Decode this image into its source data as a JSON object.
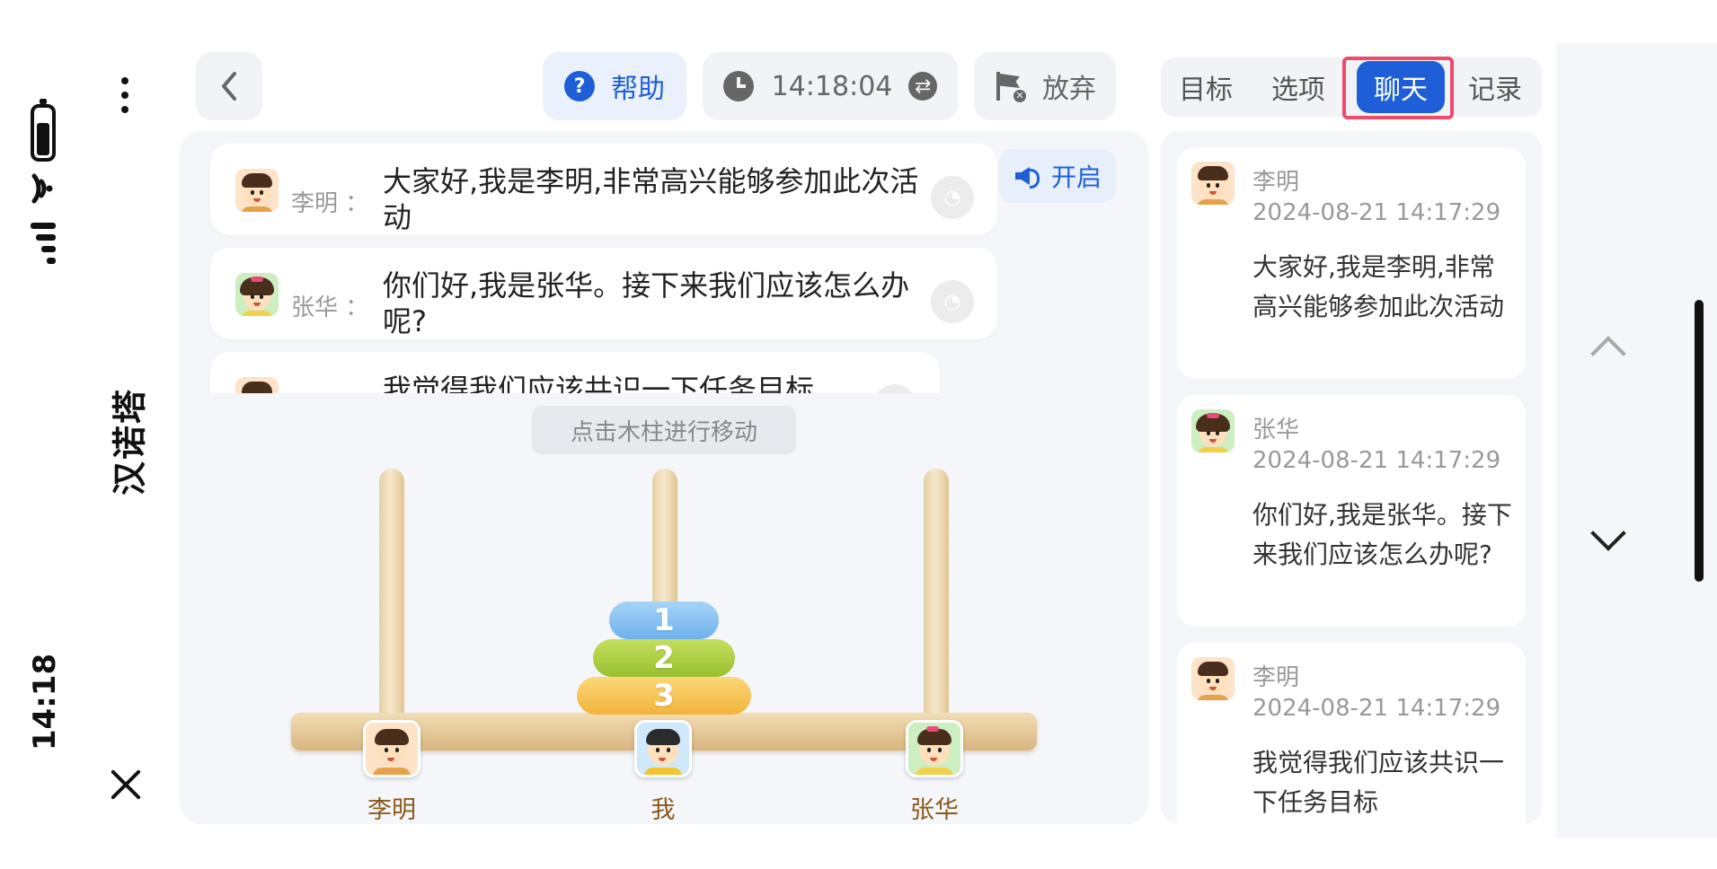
{
  "status_bar": {
    "time": "14:18",
    "icons": [
      "battery-icon",
      "wifi-icon",
      "signal-icon"
    ]
  },
  "app": {
    "title": "汉诺塔",
    "menu_icon": "more-vertical-icon",
    "close_icon": "close-icon"
  },
  "toolbar": {
    "back_icon": "chevron-left-icon",
    "help_label": "帮助",
    "timer_value": "14:18:04",
    "giveup_label": "放弃"
  },
  "tabs": [
    {
      "label": "目标",
      "active": false
    },
    {
      "label": "选项",
      "active": false
    },
    {
      "label": "聊天",
      "active": true
    },
    {
      "label": "记录",
      "active": false
    }
  ],
  "chat": {
    "separator": "：",
    "sound_toggle_label": "开启",
    "messages": [
      {
        "name": "李明",
        "text": "大家好,我是李明,非常高兴能够参加此次活动"
      },
      {
        "name": "张华",
        "text": "你们好,我是张华。接下来我们应该怎么办呢?"
      },
      {
        "name": "李明",
        "text": "我觉得我们应该共识一下任务目标"
      }
    ]
  },
  "game": {
    "hint": "点击木柱进行移动",
    "disks": [
      "1",
      "2",
      "3"
    ],
    "players": [
      "李明",
      "我",
      "张华"
    ]
  },
  "log": {
    "entries": [
      {
        "name": "李明",
        "time": "2024-08-21 14:17:29",
        "text": "大家好,我是李明,非常高兴能够参加此次活动"
      },
      {
        "name": "张华",
        "time": "2024-08-21 14:17:29",
        "text": "你们好,我是张华。接下来我们应该怎么办呢?"
      },
      {
        "name": "李明",
        "time": "2024-08-21 14:17:29",
        "text": "我觉得我们应该共识一下任务目标"
      }
    ]
  },
  "colors": {
    "accent": "#1e5fd8",
    "highlight": "#ee4b6a",
    "disk_1": "#7dbdf0",
    "disk_2": "#a8cc3c",
    "disk_3": "#f5bd4a"
  }
}
